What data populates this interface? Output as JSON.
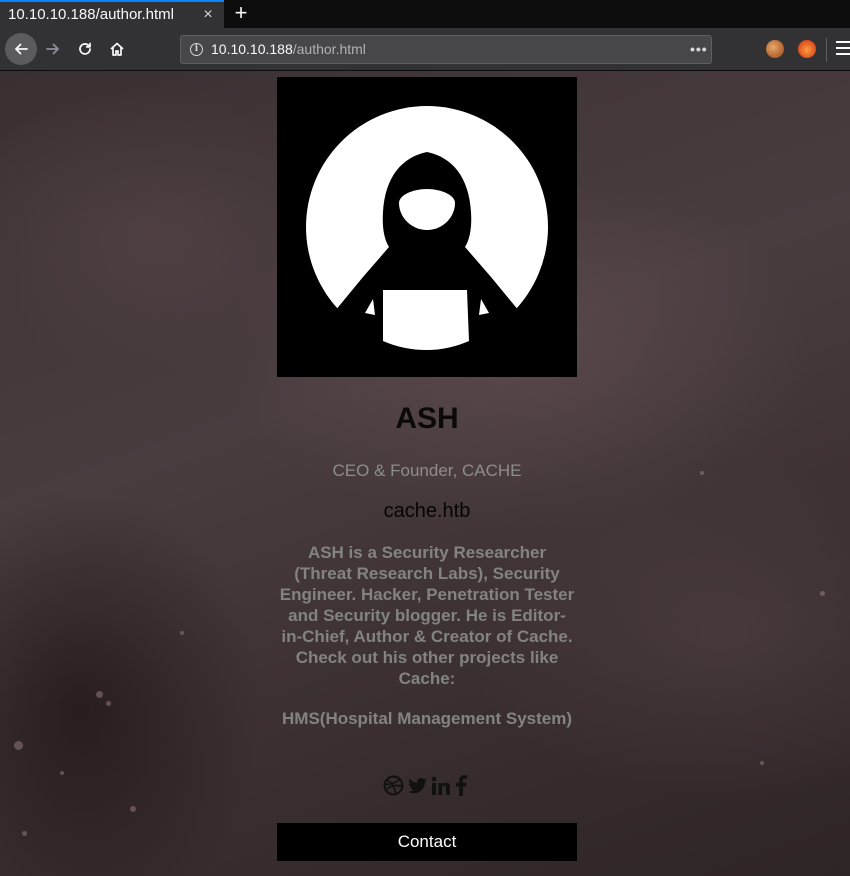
{
  "browser": {
    "tab_title": "10.10.10.188/author.html",
    "tab_close": "×",
    "new_tab": "+",
    "url_host": "10.10.10.188",
    "url_path": "/author.html",
    "page_actions": "•••"
  },
  "author": {
    "name": "ASH",
    "title": "CEO & Founder, CACHE",
    "site": "cache.htb",
    "bio": "ASH is a Security Researcher (Threat Research Labs), Security Engineer. Hacker, Penetration Tester and Security blogger. He is Editor-in-Chief, Author & Creator of Cache. Check out his other projects like Cache:",
    "projects": "HMS(Hospital Management System)",
    "contact_label": "Contact",
    "social_icons": [
      "dribbble-icon",
      "twitter-icon",
      "linkedin-icon",
      "facebook-icon"
    ]
  },
  "colors": {
    "tab_accent": "#0a84ff",
    "contact_bg": "#000000"
  }
}
